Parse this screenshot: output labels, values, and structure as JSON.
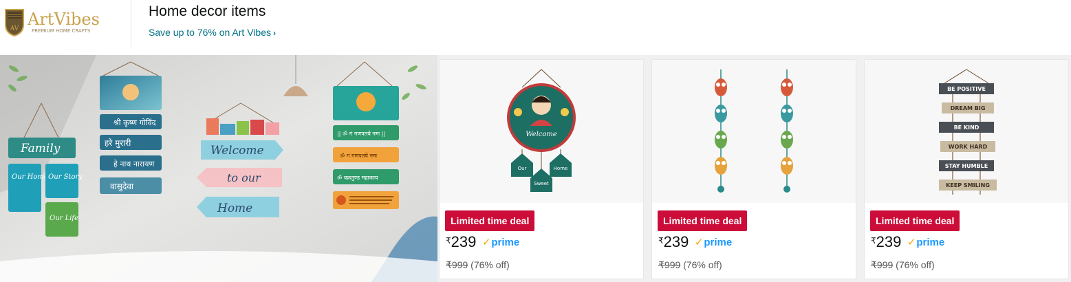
{
  "brand": {
    "name": "ArtVibes",
    "tagline": "PREMIUM HOME CRAFTS",
    "monogram": "AV",
    "gold": "#C9A24B",
    "brown": "#6B5632"
  },
  "header": {
    "title": "Home decor items",
    "link_label": "Save up to 76% on Art Vibes",
    "link_chevron": "›"
  },
  "hero": {
    "signs": {
      "family": "Family",
      "our_home": "Our Home",
      "our_story": "Our Story",
      "our_life": "Our Life",
      "welcome": "Welcome",
      "to_our": "to our",
      "home": "Home",
      "hindi_1": "श्री कृष्ण गोविंद",
      "hindi_2": "हरे मुरारी",
      "hindi_3": "हे नाथ नारायण",
      "hindi_4": "वासुदेवा",
      "mantra_1": "|| ॐ गं गणपतये नमः ||",
      "mantra_2": "ॐ गं गणपतये नमः",
      "mantra_3": "ॐ वक्रतुण्ड महाकाय"
    }
  },
  "products": [
    {
      "name": "Welcome wall hanging",
      "badge": "Limited time deal",
      "currency": "₹",
      "price": "239",
      "prime_label": "prime",
      "list_price": "₹999",
      "discount": "(76% off)",
      "image_text": {
        "welcome": "Welcome",
        "our": "Our",
        "sweet": "Sweet",
        "home": "Home"
      }
    },
    {
      "name": "Owl wall hanging",
      "badge": "Limited time deal",
      "currency": "₹",
      "price": "239",
      "prime_label": "prime",
      "list_price": "₹999",
      "discount": "(76% off)"
    },
    {
      "name": "Motivational quotes wall hanging",
      "badge": "Limited time deal",
      "currency": "₹",
      "price": "239",
      "prime_label": "prime",
      "list_price": "₹999",
      "discount": "(76% off)",
      "image_text": {
        "q1": "BE POSITIVE",
        "q2": "DREAM BIG",
        "q3": "BE KIND",
        "q4": "WORK HARD",
        "q5": "STAY HUMBLE",
        "q6": "KEEP SMILING"
      }
    }
  ],
  "colors": {
    "deal": "#CC0C39",
    "link": "#007185",
    "prime_blue": "#1a98ff",
    "prime_check": "#f7a400",
    "text": "#0F1111",
    "muted": "#565959"
  }
}
